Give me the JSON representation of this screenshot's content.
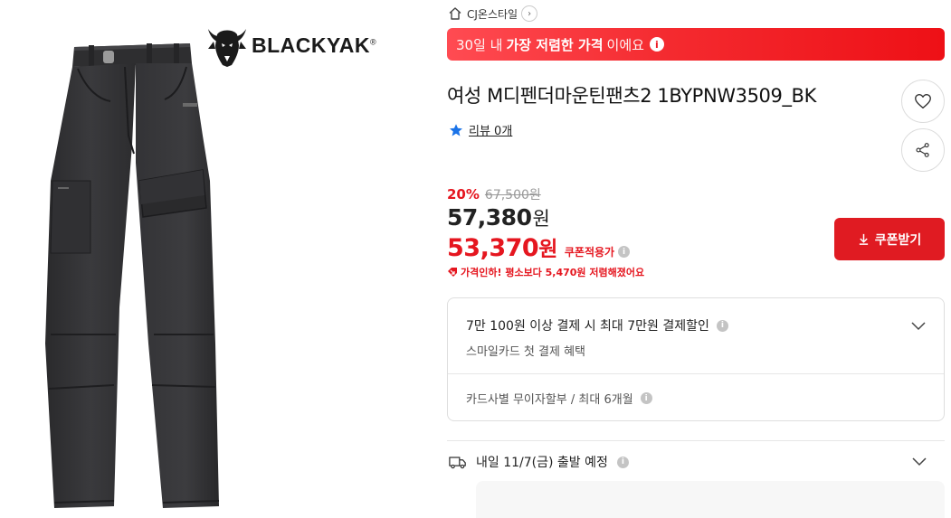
{
  "gallery": {
    "brand_name": "BLACKYAK",
    "brand_mark": "®",
    "image_icon": "product-pants-image"
  },
  "shop": {
    "label": "CJ온스타일",
    "icon": "home-icon",
    "arrow": "›"
  },
  "banner": {
    "prefix": "30일 내",
    "strong": "가장 저렴한 가격",
    "suffix": "이에요",
    "info": "i",
    "colors": {
      "start": "#ff4b52",
      "end": "#ee1016"
    }
  },
  "product": {
    "title": "여성 M디펜더마운틴팬츠2 1BYPNW3509_BK"
  },
  "review": {
    "label": "리뷰 0개",
    "icon": "star-icon",
    "star_color": "#1a73e8"
  },
  "price": {
    "discount_rate": "20%",
    "original": "67,500원",
    "sale_amount": "57,380",
    "sale_unit": "원",
    "coupon_amount": "53,370",
    "coupon_unit": "원",
    "coupon_label": "쿠폰적용가",
    "info": "i",
    "price_drop": "가격인하! 평소보다 5,470원 저렴해졌어요",
    "accent": "#e5161f"
  },
  "coupon_button": {
    "label": "쿠폰받기",
    "icon": "download-icon"
  },
  "benefits": {
    "headline": "7만 100원 이상 결제 시 최대 7만원 결제할인",
    "sub": "스마일카드 첫 결제 혜택",
    "installment": "카드사별 무이자할부 / 최대 6개월",
    "info": "i"
  },
  "delivery": {
    "label": "내일 11/7(금) 출발 예정",
    "icon": "truck-icon",
    "info": "i"
  },
  "actions": {
    "wish_icon": "heart-icon",
    "share_icon": "share-icon"
  }
}
